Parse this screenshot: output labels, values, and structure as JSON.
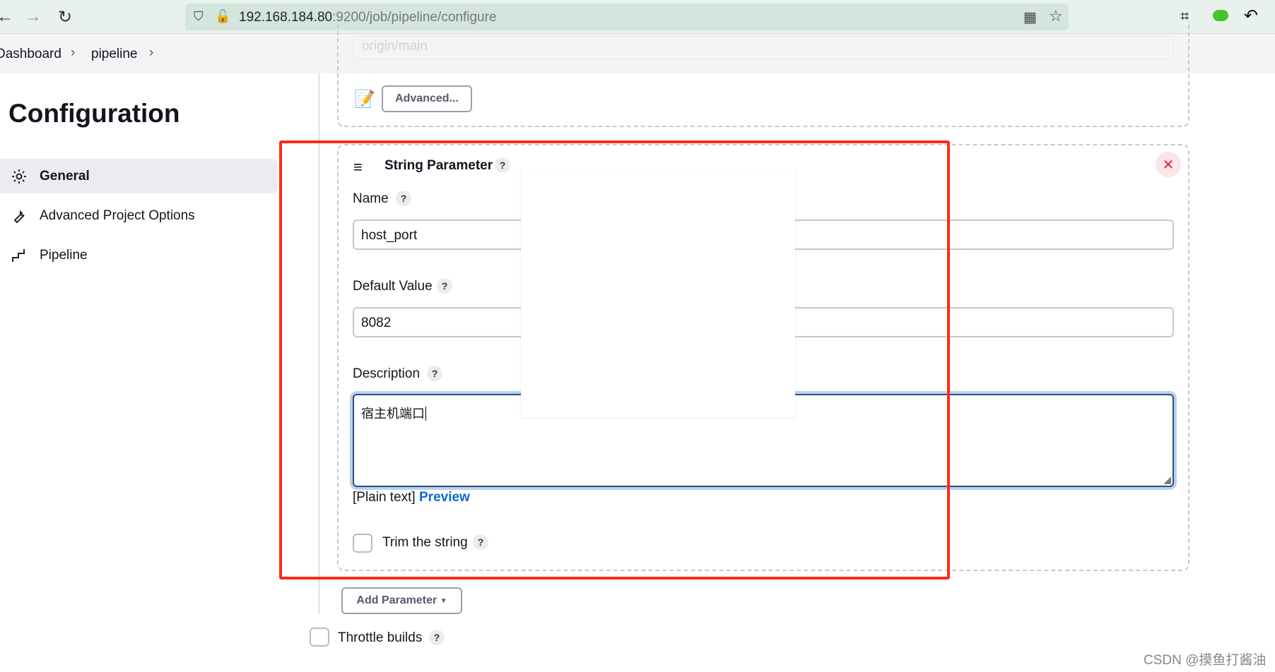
{
  "browser": {
    "url_host": "192.168.184.80",
    "url_rest": ":9200/job/pipeline/configure"
  },
  "breadcrumb": [
    "Dashboard",
    "pipeline"
  ],
  "page_title": "Configuration",
  "sidebar": {
    "items": [
      {
        "label": "General",
        "icon": "gear-icon",
        "active": true
      },
      {
        "label": "Advanced Project Options",
        "icon": "wrench-icon"
      },
      {
        "label": "Pipeline",
        "icon": "pipeline-icon"
      }
    ]
  },
  "upper": {
    "branch_placeholder": "origin/main",
    "advanced_label": "Advanced..."
  },
  "param": {
    "header": "String Parameter",
    "help": "?",
    "name_label": "Name",
    "name_value": "host_port",
    "default_label": "Default Value",
    "default_value": "8082",
    "description_label": "Description",
    "description_value": "宿主机端口",
    "plain_text": "[Plain text]",
    "preview": "Preview",
    "trim_label": "Trim the string"
  },
  "add_parameter_label": "Add Parameter",
  "throttle_label": "Throttle builds",
  "watermark": "CSDN @摸鱼打酱油",
  "colors": {
    "annotation_red": "#ff2a1a",
    "link": "#0b6bcb",
    "close_red": "#e5203a"
  }
}
